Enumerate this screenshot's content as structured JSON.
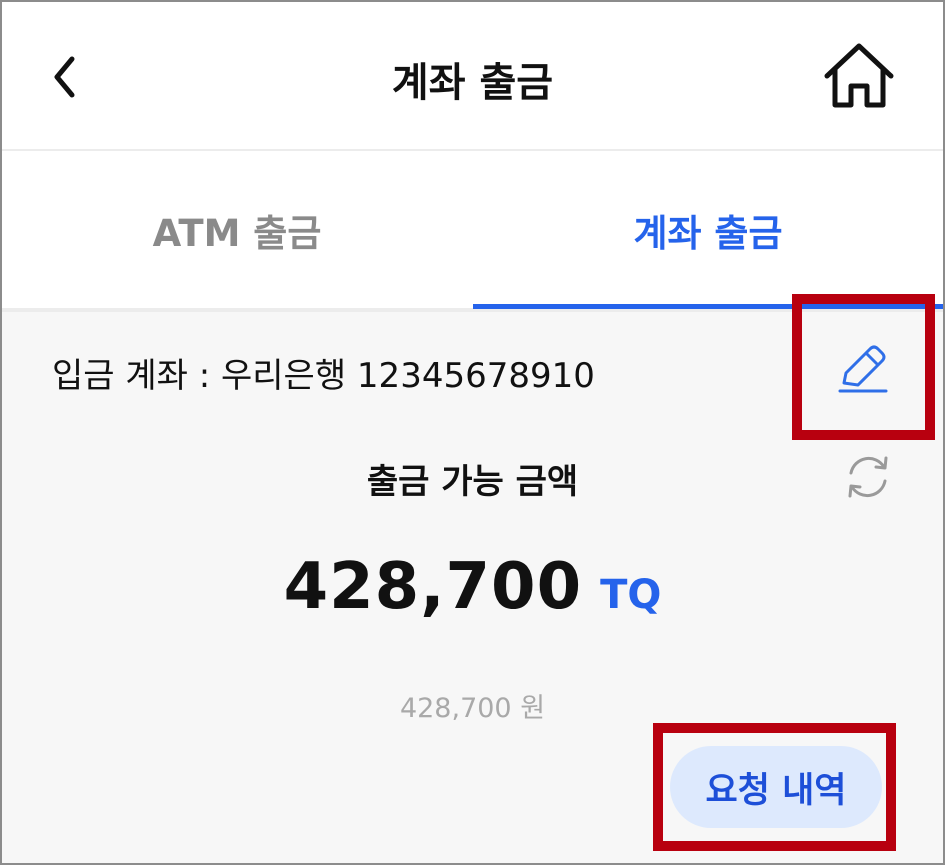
{
  "header": {
    "title": "계좌 출금",
    "back_icon": "chevron-left-icon",
    "home_icon": "home-icon"
  },
  "tabs": [
    {
      "label": "ATM 출금",
      "active": false
    },
    {
      "label": "계좌 출금",
      "active": true
    }
  ],
  "account": {
    "label": "입금 계좌 : 우리은행 12345678910",
    "edit_icon": "pencil-icon"
  },
  "balance": {
    "label": "출금 가능 금액",
    "refresh_icon": "refresh-icon",
    "amount": "428,700",
    "unit": "TQ",
    "won": "428,700 원"
  },
  "history_button": {
    "label": "요청 내역"
  },
  "colors": {
    "accent": "#2563eb",
    "button_bg": "#dde9fd",
    "highlight": "#b8000f",
    "muted_text": "#a9a9a9"
  }
}
